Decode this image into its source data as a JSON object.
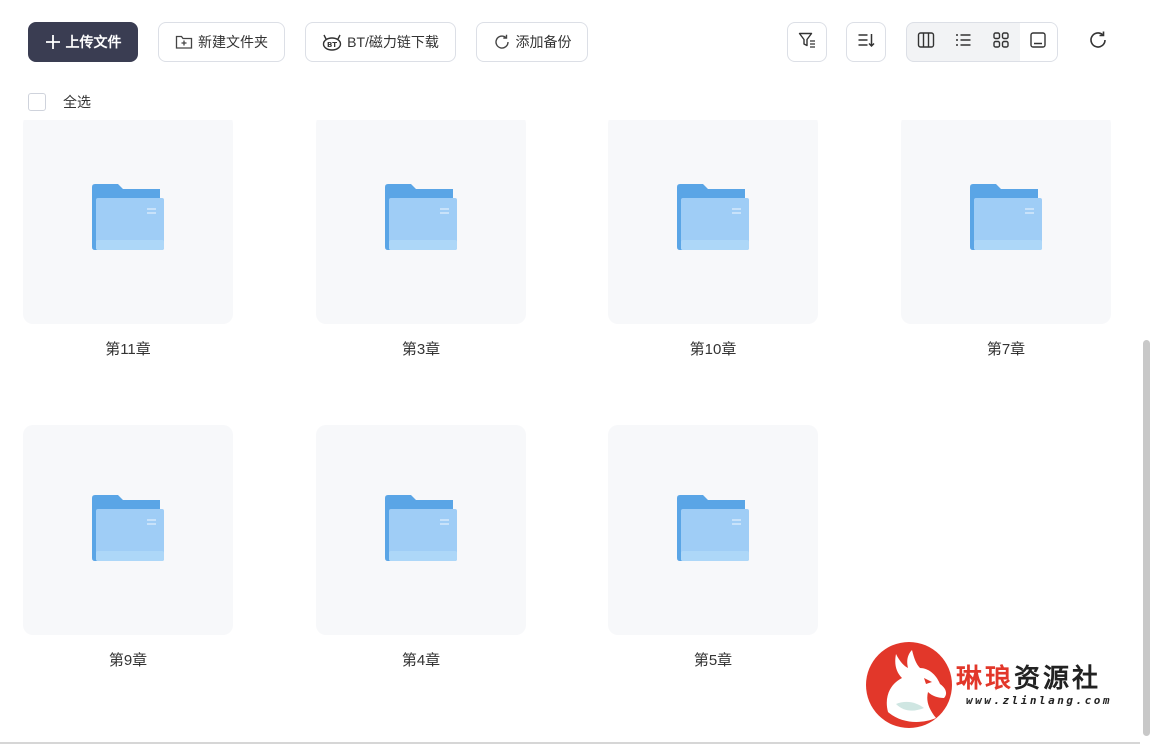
{
  "toolbar": {
    "upload_label": "上传文件",
    "new_folder_label": "新建文件夹",
    "bt_label": "BT/磁力链下载",
    "backup_label": "添加备份"
  },
  "select_all_label": "全选",
  "view_modes": [
    "column-view",
    "list-view",
    "grid-view",
    "preview-view"
  ],
  "active_view": "preview-view",
  "folders": [
    {
      "name": "第11章"
    },
    {
      "name": "第3章"
    },
    {
      "name": "第10章"
    },
    {
      "name": "第7章"
    },
    {
      "name": "第9章"
    },
    {
      "name": "第4章"
    },
    {
      "name": "第5章"
    }
  ],
  "watermark": {
    "title_red": "琳琅",
    "title_dark": "资源社",
    "url": "www.zlinlang.com"
  },
  "colors": {
    "primary_button": "#3a3d52",
    "folder_back": "#5aa5e6",
    "folder_front": "#9fcdf6",
    "watermark_red": "#e2372a"
  }
}
